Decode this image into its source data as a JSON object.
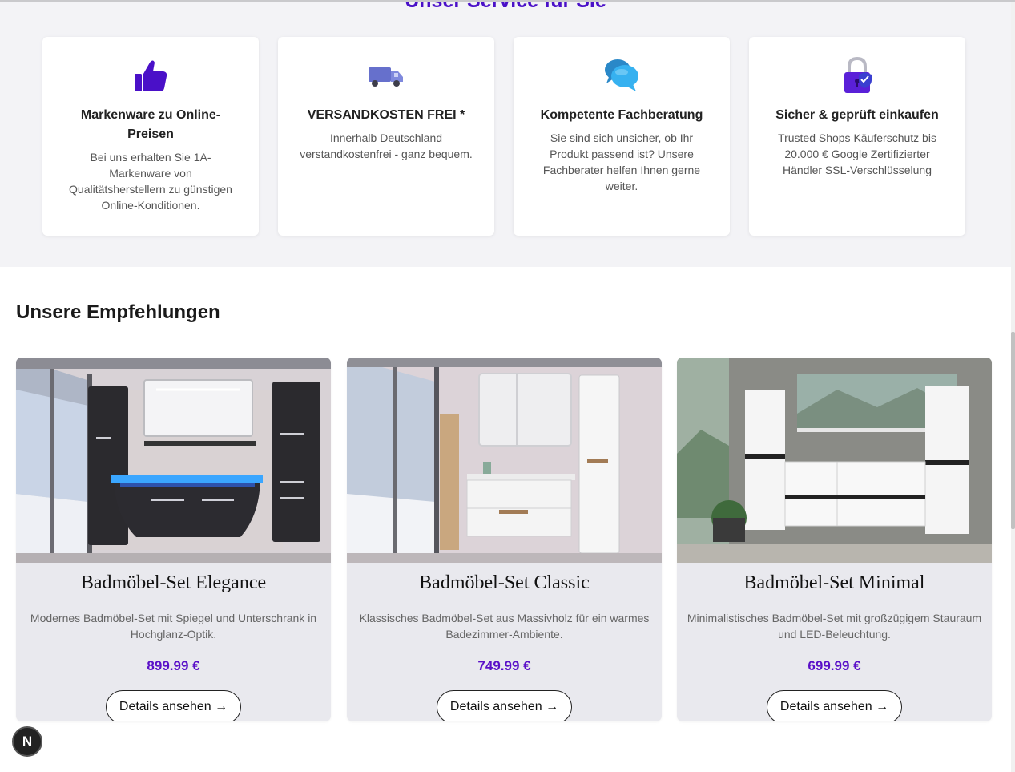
{
  "service": {
    "title": "Unser Service für Sie",
    "cards": [
      {
        "icon": "thumbs-up-icon",
        "title": "Markenware zu Online-Preisen",
        "text": "Bei uns erhalten Sie 1A-Markenware von Qualitätsherstellern zu günstigen Online-Konditionen."
      },
      {
        "icon": "delivery-truck-icon",
        "title": "VERSANDKOSTEN FREI *",
        "text": "Innerhalb Deutschland verstandkostenfrei - ganz bequem."
      },
      {
        "icon": "chat-bubbles-icon",
        "title": "Kompetente Fachberatung",
        "text": "Sie sind sich unsicher, ob Ihr Produkt passend ist? Unsere Fachberater helfen Ihnen gerne weiter."
      },
      {
        "icon": "security-lock-icon",
        "title": "Sicher & geprüft einkaufen",
        "text": "Trusted Shops Käuferschutz bis 20.000 € Google Zertifizierter Händler SSL-Verschlüsselung"
      }
    ]
  },
  "recommendations": {
    "title": "Unsere Empfehlungen",
    "products": [
      {
        "name": "Badmöbel-Set Elegance",
        "description": "Modernes Badmöbel-Set mit Spiegel und Unterschrank in Hochglanz-Optik.",
        "price": "899.99 €",
        "button": "Details ansehen →"
      },
      {
        "name": "Badmöbel-Set Classic",
        "description": "Klassisches Badmöbel-Set aus Massivholz für ein warmes Badezimmer-Ambiente.",
        "price": "749.99 €",
        "button": "Details ansehen →"
      },
      {
        "name": "Badmöbel-Set Minimal",
        "description": "Minimalistisches Badmöbel-Set mit großzügigem Stauraum und LED-Beleuchtung.",
        "price": "699.99 €",
        "button": "Details ansehen →"
      }
    ]
  },
  "badge": {
    "letter": "N"
  },
  "colors": {
    "accent": "#5a10c8",
    "service_bg": "#f3f3f6",
    "card_bg": "#e9e9ee"
  }
}
